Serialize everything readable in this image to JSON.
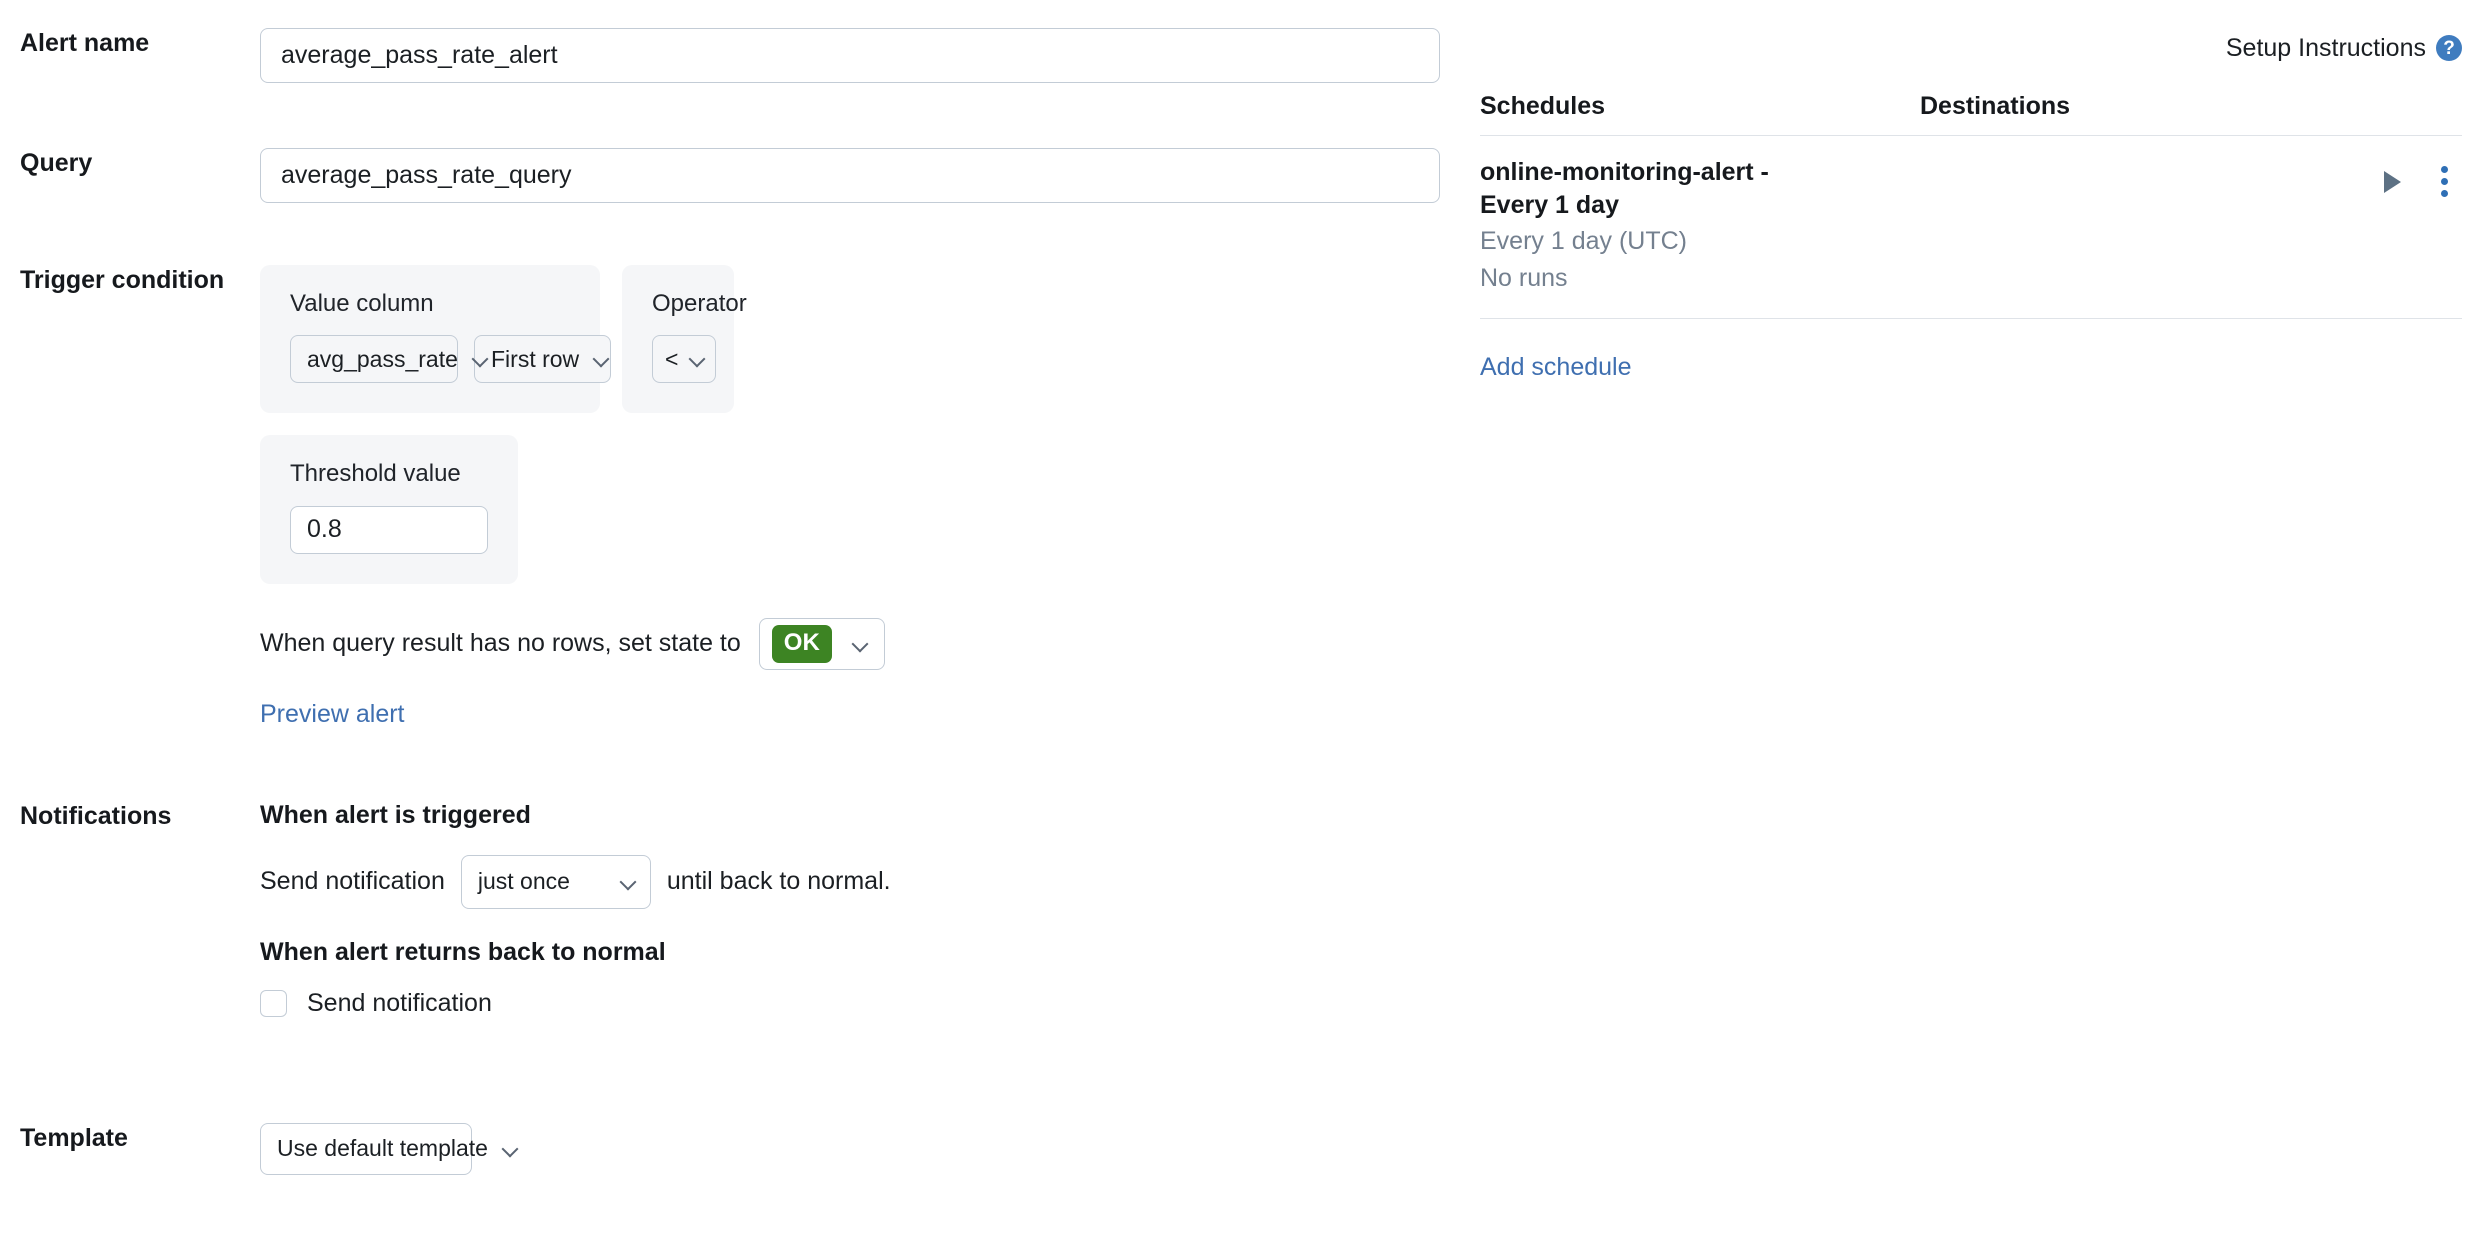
{
  "form": {
    "alert_name": {
      "label": "Alert name",
      "value": "average_pass_rate_alert",
      "placeholder": "Alert name"
    },
    "query": {
      "label": "Query",
      "value": "average_pass_rate_query",
      "placeholder": "Query"
    },
    "trigger_condition": {
      "label": "Trigger condition",
      "value_column": {
        "panel_label": "Value column",
        "column_value": "avg_pass_rate",
        "aggregation_value": "First row"
      },
      "operator": {
        "panel_label": "Operator",
        "value": "<"
      },
      "threshold": {
        "panel_label": "Threshold value",
        "value": "0.8"
      },
      "no_rows": {
        "prefix_text": "When query result has no rows, set state to",
        "state_value": "OK",
        "state_color": "#3d8423"
      },
      "preview_link": "Preview alert"
    },
    "notifications": {
      "label": "Notifications",
      "triggered_heading": "When alert is triggered",
      "send_notification_prefix": "Send notification",
      "frequency_value": "just once",
      "send_notification_suffix": "until back to normal.",
      "normal_heading": "When alert returns back to normal",
      "normal_checkbox_label": "Send notification",
      "normal_checkbox_checked": false
    },
    "template": {
      "label": "Template",
      "value": "Use default template"
    }
  },
  "right_panel": {
    "setup_instructions": "Setup Instructions",
    "columns": {
      "schedules": "Schedules",
      "destinations": "Destinations"
    },
    "schedules": [
      {
        "name": "online-monitoring-alert - Every 1 day",
        "cadence": "Every 1 day (UTC)",
        "last_run": "No runs",
        "destinations": ""
      }
    ],
    "add_schedule_link": "Add schedule"
  },
  "colors": {
    "link": "#3f6fb0",
    "ok_green": "#3d8423",
    "help_blue": "#3f7cbf",
    "kebab_blue": "#2f6fb5",
    "panel_bg": "#f5f6f8",
    "border": "#c3ccd6",
    "muted_text": "#74808f"
  }
}
